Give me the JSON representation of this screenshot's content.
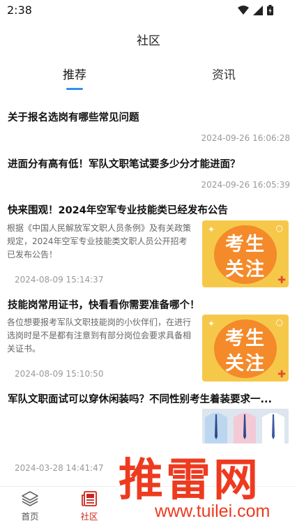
{
  "status_bar": {
    "time": "2:38"
  },
  "header": {
    "title": "社区"
  },
  "tabs": [
    {
      "label": "推荐",
      "active": true
    },
    {
      "label": "资讯",
      "active": false
    }
  ],
  "articles": [
    {
      "title": "关于报名选岗有哪些常见问题",
      "time": "2024-09-26 16:06:28"
    },
    {
      "title": "进面分有高有低！军队文职笔试要多少分才能进面？",
      "time": "2024-09-26 16:05:39"
    },
    {
      "title": "快来围观！2024年空军专业技能类已经发布公告",
      "summary": "根据《中国人民解放军文职人员条例》及有关政策规定，2024年空军专业技能类文职人员公开招考已发布公告！",
      "time": "2024-08-09 15:14:37",
      "thumb_text": [
        "考生",
        "关注"
      ]
    },
    {
      "title": "技能岗常用证书，快看看你需要准备哪个！",
      "summary": "各位想要报考军队文职技能岗的小伙伴们，在进行选岗时是不是都有注意到有部分岗位会要求具备相关证书。",
      "time": "2024-08-09 15:10:50",
      "thumb_text": [
        "考生",
        "关注"
      ]
    },
    {
      "title": "军队文职面试可以穿休闲装吗？不同性别考生着装要求一...",
      "time": "2024-03-28 14:41:47"
    }
  ],
  "bottom_nav": [
    {
      "label": "首页",
      "icon": "layers-icon"
    },
    {
      "label": "社区",
      "icon": "newspaper-icon",
      "active": true
    }
  ],
  "watermark": {
    "text": "推雷网",
    "url": "www.tuilei.com"
  },
  "colors": {
    "accent_blue": "#2f8ff5",
    "active_red": "#c8261c",
    "badge_orange": "#f48a2a",
    "badge_yellow": "#f6c84a",
    "watermark_red": "#ee3a1f"
  }
}
